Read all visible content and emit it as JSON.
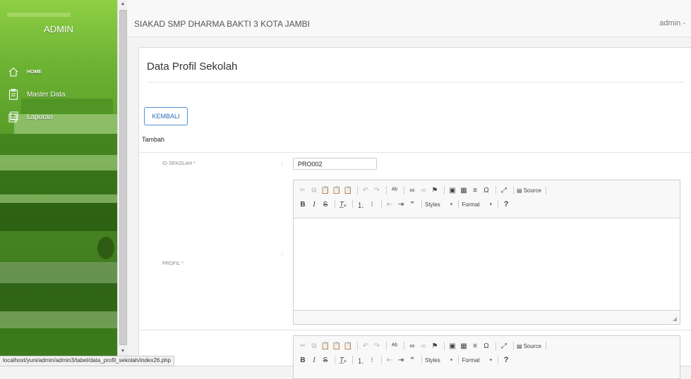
{
  "sidebar": {
    "title": "ADMIN",
    "items": [
      {
        "label": "HOME",
        "icon": "home-icon"
      },
      {
        "label": "Master Data",
        "icon": "clipboard-icon"
      },
      {
        "label": "Laporan",
        "icon": "report-icon"
      }
    ]
  },
  "header": {
    "app_title": "SIAKAD SMP DHARMA BAKTI 3 KOTA JAMBI",
    "user_menu": "admin -"
  },
  "main": {
    "page_title": "Data Profil Sekolah",
    "back_button": "KEMBALI",
    "section_title": "Tambah",
    "fields": {
      "id_label": "ID SEKOLAH *",
      "id_value": "PRO002",
      "profil_label": "PROFIL *",
      "colon": ":"
    },
    "editor": {
      "source_label": "Source",
      "styles_label": "Styles",
      "format_label": "Format",
      "help_label": "?"
    }
  },
  "statusbar": {
    "url": "localhost/yuni/admin/admin3/tabel/data_profil_sekolah/index26.php"
  },
  "colors": {
    "sidebar_green": "#6cb233",
    "accent_blue": "#2e6db4"
  }
}
